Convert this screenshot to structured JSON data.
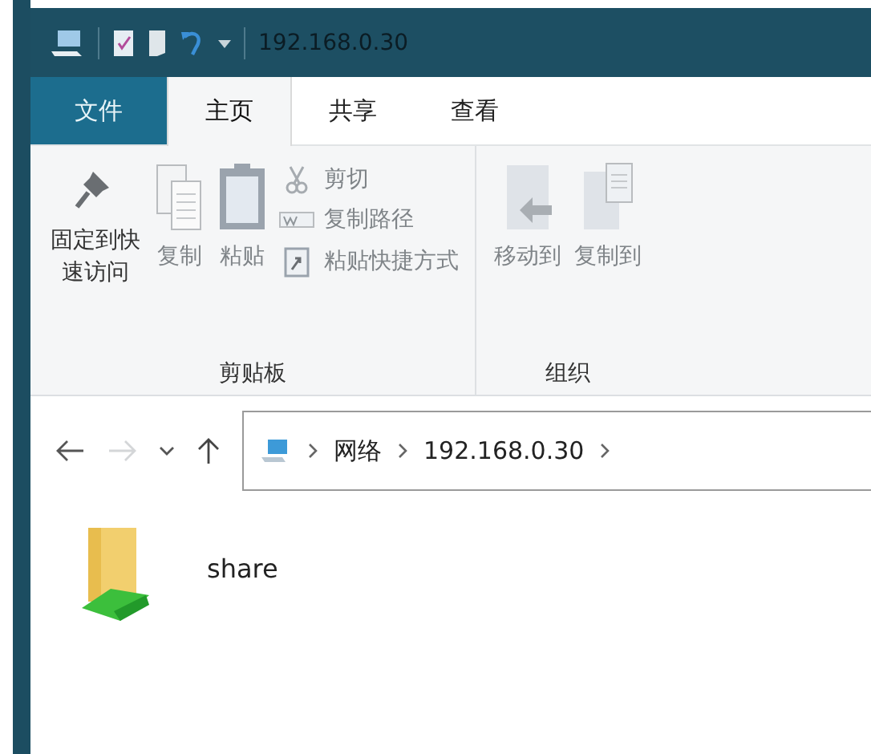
{
  "window": {
    "title": "192.168.0.30"
  },
  "tabs": [
    {
      "label": "文件",
      "kind": "file",
      "selected": false
    },
    {
      "label": "主页",
      "kind": "tab",
      "selected": true
    },
    {
      "label": "共享",
      "kind": "tab",
      "selected": false
    },
    {
      "label": "查看",
      "kind": "tab",
      "selected": false
    }
  ],
  "ribbon": {
    "groups": [
      {
        "label": "剪贴板",
        "large": [
          {
            "label": "固定到快速访问",
            "disabled": false
          },
          {
            "label": "复制",
            "disabled": true
          },
          {
            "label": "粘贴",
            "disabled": true
          }
        ],
        "small": [
          {
            "label": "剪切",
            "disabled": true
          },
          {
            "label": "复制路径",
            "disabled": true
          },
          {
            "label": "粘贴快捷方式",
            "disabled": true
          }
        ]
      },
      {
        "label": "组织",
        "large": [
          {
            "label": "移动到",
            "disabled": true
          },
          {
            "label": "复制到",
            "disabled": true
          }
        ]
      }
    ]
  },
  "navigation": {
    "back_disabled": false,
    "forward_disabled": true
  },
  "address": {
    "segments": [
      "网络",
      "192.168.0.30"
    ]
  },
  "items": [
    {
      "name": "share"
    }
  ]
}
